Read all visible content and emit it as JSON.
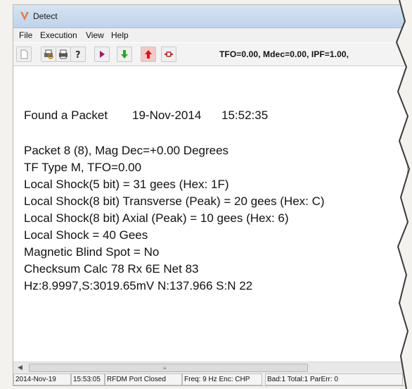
{
  "window": {
    "title": "Detect"
  },
  "menu": [
    "File",
    "Execution",
    "View",
    "Help"
  ],
  "toolbar": {
    "buttons": [
      {
        "icon": "new-document-icon"
      },
      {
        "icon": "print-preview-icon"
      },
      {
        "icon": "print-icon"
      },
      {
        "icon": "help-icon"
      },
      {
        "icon": "play-icon"
      },
      {
        "icon": "download-arrow-icon"
      },
      {
        "icon": "upload-red-icon"
      },
      {
        "icon": "connect-icon"
      }
    ],
    "status_text": "TFO=0.00, Mdec=0.00, IPF=1.00,"
  },
  "packet": {
    "found_label": "Found a Packet",
    "date": "19-Nov-2014",
    "time": "15:52:35",
    "lines": [
      "Packet 8 (8), Mag Dec=+0.00 Degrees",
      "TF Type M, TFO=0.00",
      "Local Shock(5 bit) = 31 gees (Hex: 1F)",
      "Local Shock(8 bit) Transverse (Peak) = 20 gees (Hex: C)",
      "Local Shock(8 bit) Axial (Peak) = 10 gees (Hex: 6)",
      "Local Shock = 40 Gees",
      "Magnetic Blind Spot = No",
      "Checksum Calc 78 Rx 6E Net 83",
      "Hz:8.9997,S:3019.65mV N:137.966 S:N 22"
    ]
  },
  "statusbar": {
    "date": "2014-Nov-19",
    "time": "15:53:05",
    "port": "RFDM Port Closed",
    "freq": "Freq: 9 Hz Enc: CHP",
    "counts": "Bad:1 Total:1 ParErr: 0"
  },
  "colors": {
    "titlebar": "#c9dbee",
    "toolbar_text": "#111111"
  }
}
